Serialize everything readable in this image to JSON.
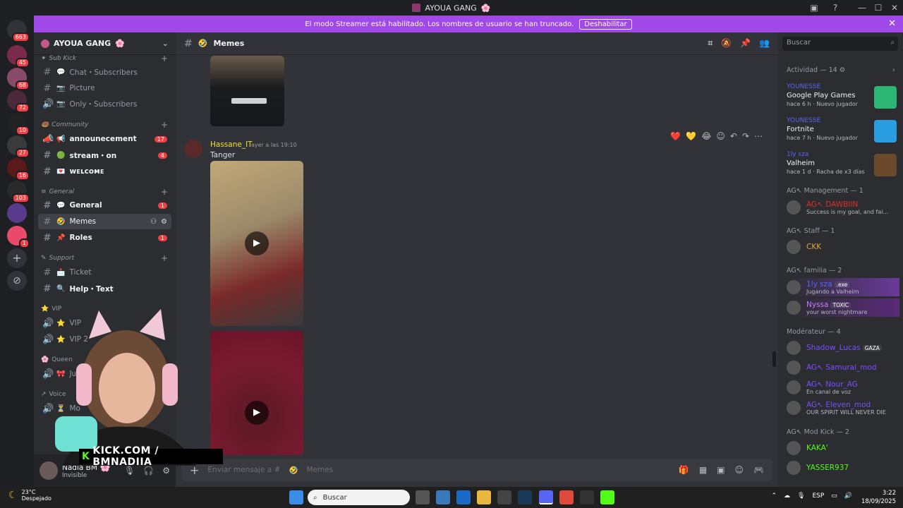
{
  "window": {
    "title": "AYOUA GANG",
    "title_emoji": "🌸"
  },
  "banner": {
    "text": "El modo Streamer está habilitado. Los nombres de usuario se han truncado.",
    "button": "Deshabilitar"
  },
  "guilds": {
    "dm_badge": "663",
    "badges": [
      "45",
      "68",
      "72",
      "10",
      "27",
      "16",
      "103",
      "",
      "1"
    ]
  },
  "server": {
    "name": "AYOUA GANG",
    "emoji": "🌸"
  },
  "categories": [
    {
      "label": "Sub Kick",
      "emoji": "✦"
    },
    {
      "label": "Community",
      "emoji": "🍩"
    },
    {
      "label": "General",
      "emoji": "≡"
    },
    {
      "label": "Support",
      "emoji": "✎"
    },
    {
      "label": "VIP",
      "emoji": "⭐"
    },
    {
      "label": "Queen",
      "emoji": "🌸"
    },
    {
      "label": "Voice",
      "emoji": "↗"
    }
  ],
  "channels": [
    {
      "name": "Chat・Subscribers",
      "emoji": "💬",
      "icon": "#",
      "badge": ""
    },
    {
      "name": "Picture",
      "emoji": "📷",
      "icon": "#",
      "badge": ""
    },
    {
      "name": "Only・Subscribers",
      "emoji": "📷",
      "icon": "🔊",
      "badge": ""
    },
    {
      "name": "announecement",
      "emoji": "📢",
      "icon": "📣",
      "badge": "17"
    },
    {
      "name": "stream・on",
      "emoji": "🟢",
      "icon": "#",
      "badge": "4"
    },
    {
      "name": "ᴡᴇʟᴄᴏᴍᴇ",
      "emoji": "💌",
      "icon": "#",
      "badge": ""
    },
    {
      "name": "General",
      "emoji": "💬",
      "icon": "#",
      "badge": "1"
    },
    {
      "name": "Memes",
      "emoji": "🤣",
      "icon": "#",
      "badge": ""
    },
    {
      "name": "Roles",
      "emoji": "📌",
      "icon": "#",
      "badge": "1"
    },
    {
      "name": "Ticket",
      "emoji": "📩",
      "icon": "#",
      "badge": ""
    },
    {
      "name": "Help・Text",
      "emoji": "🔍",
      "icon": "#",
      "badge": ""
    },
    {
      "name": "VIP",
      "emoji": "⭐",
      "icon": "🔊",
      "badge": ""
    },
    {
      "name": "VIP 2",
      "emoji": "⭐",
      "icon": "🔊",
      "badge": ""
    },
    {
      "name": "Just G",
      "emoji": "🎀",
      "icon": "🔊",
      "badge": ""
    },
    {
      "name": "Mo",
      "emoji": "⏳",
      "icon": "🔊",
      "badge": ""
    }
  ],
  "user": {
    "name": "Nadia BM",
    "emoji": "🌸",
    "status": "Invisible"
  },
  "channel_header": {
    "name": "Memes",
    "emoji": "🤣"
  },
  "message": {
    "author": "Hassane_IT",
    "time": "ayer a las 19:10",
    "text": "Tanger"
  },
  "reactions": [
    "❤️",
    "💛",
    "😂"
  ],
  "composer": {
    "placeholder": "Enviar mensaje a #",
    "channel": "Memes",
    "emoji": "🤣"
  },
  "members": {
    "search_placeholder": "Buscar",
    "activity_header": "Actividad — 14",
    "activities": [
      {
        "who": "YOUNESSE",
        "game": "Google Play Games",
        "time": "hace 6 h",
        "tag": "Nuevo jugador",
        "color": "#2bb673"
      },
      {
        "who": "YOUNESSE",
        "game": "Fortnite",
        "time": "hace 7 h",
        "tag": "Nuevo jugador",
        "color": "#2a9de0"
      },
      {
        "who": "1ly sza",
        "game": "Valheim",
        "time": "hace 1 d",
        "tag": "Racha de x3 días",
        "color": "#6a4a2a"
      }
    ],
    "sections": [
      {
        "label": "AG↖ Management — 1",
        "members": [
          {
            "name": "AG↖ DAWBIIN",
            "sub": "Success is my goal, and fai...",
            "color": "#d9302a",
            "tag": ""
          }
        ]
      },
      {
        "label": "AG↖ Staff — 1",
        "members": [
          {
            "name": "CKK",
            "sub": "",
            "color": "#e8a33a",
            "tag": ""
          }
        ]
      },
      {
        "label": "AG↖ familia — 2",
        "members": [
          {
            "name": "1ly sza",
            "sub": "Jugando a Valheim",
            "color": "#5865f2",
            "tag": ".exe"
          },
          {
            "name": "Nyssa",
            "sub": "your worst nightmare",
            "color": "#c77dff",
            "tag": "TOXIC"
          }
        ]
      },
      {
        "label": "Modérateur — 4",
        "members": [
          {
            "name": "Shadow_Lucas",
            "sub": "",
            "color": "#7b4dff",
            "tag": "GAZA"
          },
          {
            "name": "AG↖ Samurai_mod",
            "sub": "",
            "color": "#7b4dff",
            "tag": ""
          },
          {
            "name": "AG↖ Nour_AG",
            "sub": "En canal de voz",
            "color": "#7b4dff",
            "tag": ""
          },
          {
            "name": "AG↖ Eleven_mod",
            "sub": "OUR SPIRIT WILL NEVER DIE",
            "color": "#7b4dff",
            "tag": ""
          }
        ]
      },
      {
        "label": "AG↖ Mod Kick — 2",
        "members": [
          {
            "name": "KAKA'",
            "sub": "",
            "color": "#53fc18",
            "tag": ""
          },
          {
            "name": "YASSER937",
            "sub": "",
            "color": "#53fc18",
            "tag": ""
          }
        ]
      }
    ]
  },
  "overlay": {
    "text": "KICK.COM / BMNADIIA"
  },
  "taskbar": {
    "temp": "23°C",
    "weather": "Despejado",
    "search": "Buscar",
    "lang": "ESP",
    "time": "3:22",
    "date": "18/09/2025"
  }
}
